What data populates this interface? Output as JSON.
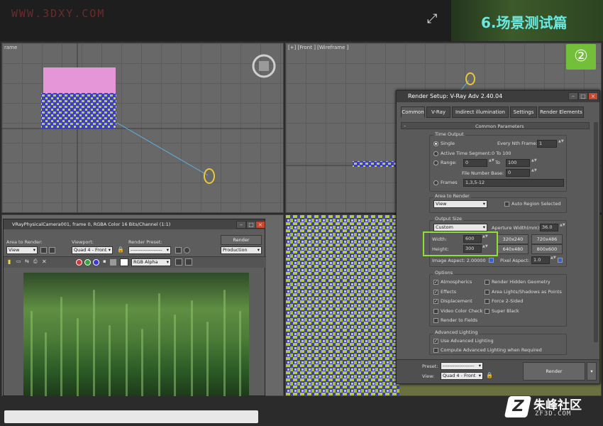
{
  "watermark": "WWW.3DXY.COM",
  "title": "6.场景测试篇",
  "step_badge": "②",
  "viewports": {
    "front_label": "[+] [Front ] [Wireframe ]",
    "persp_label": "rame"
  },
  "render_setup": {
    "window_title": "Render Setup: V-Ray Adv 2.40.04",
    "tabs": [
      "Common",
      "V-Ray",
      "Indirect illumination",
      "Settings",
      "Render Elements"
    ],
    "common_parameters": "Common Parameters",
    "time_output": {
      "title": "Time Output",
      "single": "Single",
      "every_nth_frame": "Every Nth Frame:",
      "every_nth_value": "1",
      "active_time_segment": "Active Time Segment:",
      "active_range": "0 To 100",
      "range": "Range:",
      "range_start": "0",
      "range_to": "To",
      "range_end": "100",
      "file_number_base": "File Number Base:",
      "file_number_value": "0",
      "frames": "Frames",
      "frames_value": "1,3,5-12"
    },
    "area_to_render": {
      "title": "Area to Render",
      "value": "View",
      "auto_region": "Auto Region Selected"
    },
    "output_size": {
      "title": "Output Size",
      "preset": "Custom",
      "aperture_label": "Aperture Width(mm):",
      "aperture_value": "36.0",
      "width_label": "Width:",
      "width_value": "600",
      "height_label": "Height:",
      "height_value": "300",
      "presets": [
        "320x240",
        "720x486",
        "640x480",
        "800x600"
      ],
      "image_aspect": "Image Aspect: 2.00000",
      "pixel_aspect_label": "Pixel Aspect:",
      "pixel_aspect_value": "1.0"
    },
    "options": {
      "title": "Options",
      "items_left": [
        {
          "label": "Atmospherics",
          "checked": true
        },
        {
          "label": "Effects",
          "checked": true
        },
        {
          "label": "Displacement",
          "checked": true
        },
        {
          "label": "Video Color Check",
          "checked": false
        },
        {
          "label": "Render to Fields",
          "checked": false
        }
      ],
      "items_right": [
        {
          "label": "Render Hidden Geometry",
          "checked": false
        },
        {
          "label": "Area Lights/Shadows as Points",
          "checked": false
        },
        {
          "label": "Force 2-Sided",
          "checked": false
        },
        {
          "label": "Super Black",
          "checked": false
        }
      ]
    },
    "advanced_lighting": {
      "title": "Advanced Lighting",
      "use": "Use Advanced Lighting",
      "compute": "Compute Advanced Lighting when Required"
    },
    "bottom": {
      "preset_label": "Preset:",
      "preset_value": "-------------------",
      "view_label": "View:",
      "view_value": "Quad 4 - Front",
      "render_button": "Render"
    }
  },
  "frame_buffer": {
    "title": "VRayPhysicalCamera001, frame 0, RGBA Color 16 Bits/Channel (1:1)",
    "area_to_render_label": "Area to Render:",
    "area_to_render_value": "View",
    "viewport_label": "Viewport:",
    "viewport_value": "Quad 4 - Front",
    "render_preset_label": "Render Preset:",
    "render_preset_value": "-------------------",
    "render_button": "Render",
    "production_value": "Production",
    "channel_value": "RGB Alpha"
  },
  "logo": {
    "cn": "朱峰社区",
    "url": "ZF3D.COM",
    "z": "Z"
  }
}
